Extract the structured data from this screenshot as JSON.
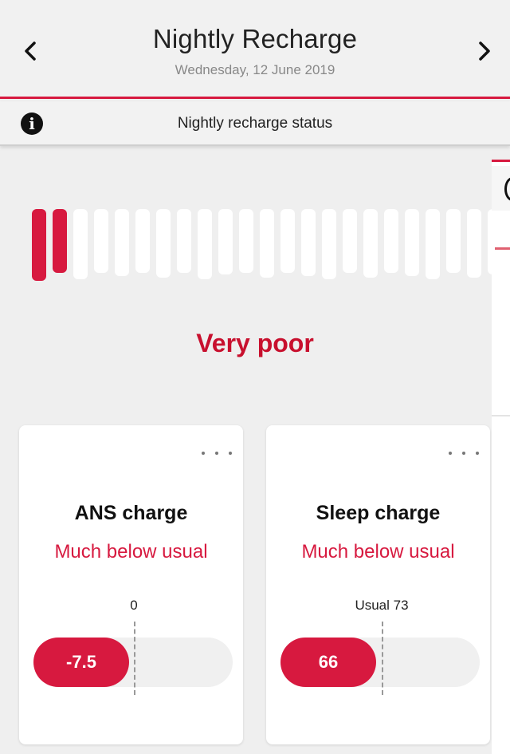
{
  "header": {
    "title": "Nightly Recharge",
    "date": "Wednesday, 12 June 2019",
    "prev_icon": "chevron-left-icon",
    "next_icon": "chevron-right-icon"
  },
  "info_bar": {
    "icon": "info-icon",
    "icon_glyph": "i",
    "text": "Nightly recharge status"
  },
  "recharge_meter": {
    "filled_bars": 2,
    "total_bars": 23,
    "filled_color": "#d7193f",
    "empty_color": "#ffffff"
  },
  "status_label": "Very poor",
  "cards": {
    "ans": {
      "title": "ANS charge",
      "status": "Much below usual",
      "reference_label": "0",
      "value": "-7.5",
      "menu_icon": "more-horizontal-icon"
    },
    "sleep": {
      "title": "Sleep charge",
      "status": "Much below usual",
      "reference_label": "Usual 73",
      "value": "66",
      "menu_icon": "more-horizontal-icon"
    }
  },
  "colors": {
    "accent": "#d7193f",
    "status_text": "#c8102e",
    "background": "#efefef"
  }
}
